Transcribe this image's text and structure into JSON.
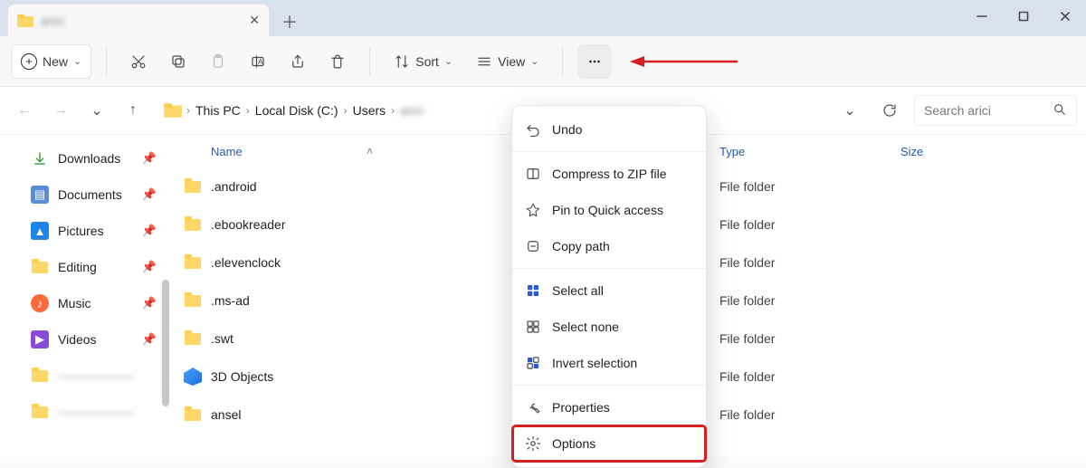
{
  "titlebar": {
    "tab_label": "arici"
  },
  "toolbar": {
    "new_label": "New",
    "sort_label": "Sort",
    "view_label": "View"
  },
  "breadcrumbs": {
    "items": [
      "This PC",
      "Local Disk (C:)",
      "Users"
    ],
    "current": "arici"
  },
  "search": {
    "placeholder": "Search arici"
  },
  "columns": {
    "name": "Name",
    "type": "Type",
    "size": "Size"
  },
  "nav": {
    "downloads": "Downloads",
    "documents": "Documents",
    "pictures": "Pictures",
    "editing": "Editing",
    "music": "Music",
    "videos": "Videos",
    "hidden1": "——————",
    "hidden2": "——————"
  },
  "rows": [
    {
      "name": ".android",
      "type": "File folder",
      "icon": "folder"
    },
    {
      "name": ".ebookreader",
      "type": "File folder",
      "icon": "folder"
    },
    {
      "name": ".elevenclock",
      "type": "File folder",
      "icon": "folder"
    },
    {
      "name": ".ms-ad",
      "type": "File folder",
      "icon": "folder"
    },
    {
      "name": ".swt",
      "type": "File folder",
      "icon": "folder"
    },
    {
      "name": "3D Objects",
      "type": "File folder",
      "icon": "3d"
    },
    {
      "name": "ansel",
      "type": "File folder",
      "icon": "folder"
    }
  ],
  "menu": {
    "undo": "Undo",
    "zip": "Compress to ZIP file",
    "pin": "Pin to Quick access",
    "copypath": "Copy path",
    "selectall": "Select all",
    "selectnone": "Select none",
    "invert": "Invert selection",
    "properties": "Properties",
    "options": "Options"
  }
}
